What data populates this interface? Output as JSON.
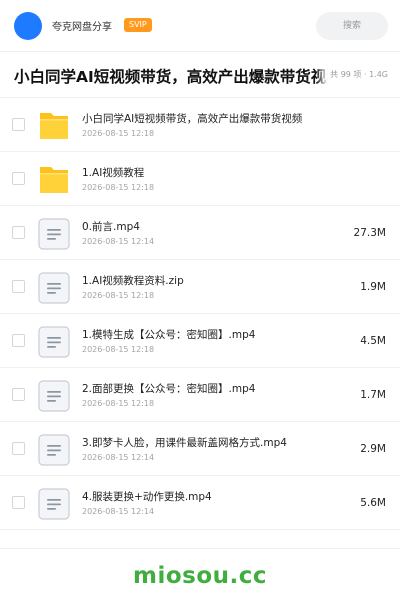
{
  "header": {
    "app_name": "夸克网盘分享",
    "badge": "SVIP",
    "search_placeholder": "搜索"
  },
  "share": {
    "title": "小白同学AI短视频带货，高效产出爆款带货视频",
    "meta": "共 99 项 · 1.4G"
  },
  "files": [
    {
      "name": "小白同学AI短视频带货，高效产出爆款带货视频",
      "date": "2026-08-15 12:18",
      "size": "",
      "icon": "folder-icon"
    },
    {
      "name": "1.AI视频教程",
      "date": "2026-08-15 12:18",
      "size": "",
      "icon": "folder-icon"
    },
    {
      "name": "0.前言.mp4",
      "date": "2026-08-15 12:14",
      "size": "27.3M",
      "icon": "file-icon"
    },
    {
      "name": "1.AI视频教程资料.zip",
      "date": "2026-08-15 12:18",
      "size": "1.9M",
      "icon": "file-icon"
    },
    {
      "name": "1.模特生成【公众号：密知圈】.mp4",
      "date": "2026-08-15 12:18",
      "size": "4.5M",
      "icon": "file-icon"
    },
    {
      "name": "2.面部更换【公众号：密知圈】.mp4",
      "date": "2026-08-15 12:18",
      "size": "1.7M",
      "icon": "file-icon"
    },
    {
      "name": "3.即梦卡人脸，用课件最新盖网格方式.mp4",
      "date": "2026-08-15 12:14",
      "size": "2.9M",
      "icon": "file-icon"
    },
    {
      "name": "4.服装更换+动作更换.mp4",
      "date": "2026-08-15 12:14",
      "size": "5.6M",
      "icon": "file-icon"
    }
  ],
  "watermark": "miosou.cc",
  "colors": {
    "avatar": "#1e7bff",
    "badge": "#ff9a1f",
    "folder": "#ffc21a",
    "watermark": "#3fae3f"
  }
}
